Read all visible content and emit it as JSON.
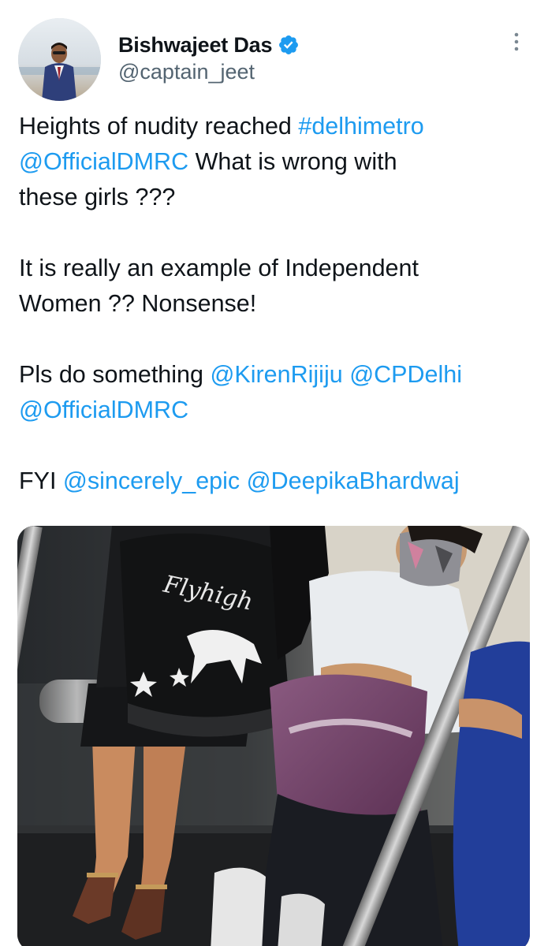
{
  "author": {
    "display_name": "Bishwajeet Das",
    "handle": "@captain_jeet",
    "verified": true,
    "avatar_icon": "profile-photo"
  },
  "menu": {
    "icon": "more-vertical-icon"
  },
  "tweet": {
    "paragraphs": [
      [
        {
          "text": "Heights of nudity reached ",
          "link": false
        },
        {
          "text": "#delhimetro",
          "link": true
        },
        {
          "text": "\n",
          "link": false
        },
        {
          "text": "@OfficialDMRC",
          "link": true
        },
        {
          "text": " What is wrong with\nthese girls ???",
          "link": false
        }
      ],
      [
        {
          "text": "It is really an example of Independent\nWomen ?? Nonsense!",
          "link": false
        }
      ],
      [
        {
          "text": "Pls do something ",
          "link": false
        },
        {
          "text": "@KirenRijiju",
          "link": true
        },
        {
          "text": " ",
          "link": false
        },
        {
          "text": "@CPDelhi",
          "link": true
        },
        {
          "text": "\n",
          "link": false
        },
        {
          "text": "@OfficialDMRC",
          "link": true
        }
      ],
      [
        {
          "text": "FYI ",
          "link": false
        },
        {
          "text": "@sincerely_epic",
          "link": true
        },
        {
          "text": " ",
          "link": false
        },
        {
          "text": "@DeepikaBhardwaj",
          "link": true
        }
      ]
    ]
  },
  "media": {
    "backpack_text": "Flyhigh"
  },
  "colors": {
    "link": "#1d9bf0",
    "text": "#0f1419",
    "secondary": "#536471",
    "verified": "#1d9bf0"
  }
}
